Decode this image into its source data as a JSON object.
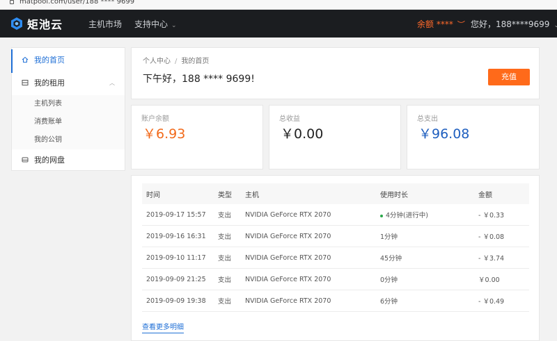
{
  "browser": {
    "url": "matpool.com/user/188 **** 9699"
  },
  "nav": {
    "logo_text": "矩池云",
    "links": [
      "主机市场",
      "支持中心"
    ],
    "balance": "余额 ****",
    "user": "您好，188****9699"
  },
  "sidebar": {
    "items": [
      {
        "label": "我的首页"
      },
      {
        "label": "我的租用"
      },
      {
        "label": "我的网盘"
      }
    ],
    "sub_items": [
      {
        "label": "主机列表"
      },
      {
        "label": "消费账单"
      },
      {
        "label": "我的公钥"
      }
    ]
  },
  "header": {
    "breadcrumb": [
      "个人中心",
      "我的首页"
    ],
    "greeting": "下午好，188 **** 9699!",
    "recharge_label": "充值"
  },
  "stats": [
    {
      "label": "账户余额",
      "value": "￥6.93",
      "color": "#f26a1b"
    },
    {
      "label": "总收益",
      "value": "￥0.00",
      "color": "#222222"
    },
    {
      "label": "总支出",
      "value": "￥96.08",
      "color": "#1f5fbf"
    }
  ],
  "table": {
    "headers": [
      "时间",
      "类型",
      "主机",
      "使用时长",
      "金额"
    ],
    "rows": [
      {
        "time": "2019-09-17 15:57",
        "type": "支出",
        "host": "NVIDIA GeForce RTX 2070",
        "duration": "4分钟(进行中)",
        "amount": "- ￥0.33",
        "active": true
      },
      {
        "time": "2019-09-16 16:31",
        "type": "支出",
        "host": "NVIDIA GeForce RTX 2070",
        "duration": "1分钟",
        "amount": "- ￥0.08",
        "active": false
      },
      {
        "time": "2019-09-10 11:17",
        "type": "支出",
        "host": "NVIDIA GeForce RTX 2070",
        "duration": "45分钟",
        "amount": "- ￥3.74",
        "active": false
      },
      {
        "time": "2019-09-09 21:25",
        "type": "支出",
        "host": "NVIDIA GeForce RTX 2070",
        "duration": "0分钟",
        "amount": "￥0.00",
        "active": false
      },
      {
        "time": "2019-09-09 19:38",
        "type": "支出",
        "host": "NVIDIA GeForce RTX 2070",
        "duration": "6分钟",
        "amount": "- ￥0.49",
        "active": false
      }
    ],
    "more_label": "查看更多明细"
  },
  "colors": {
    "accent": "#1f6fd6",
    "brand_orange": "#ff6a1a",
    "navbar": "#1b1d20"
  }
}
